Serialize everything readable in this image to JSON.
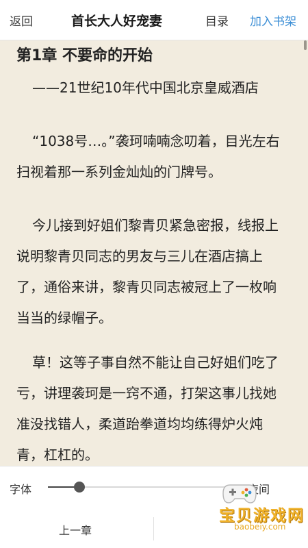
{
  "topbar": {
    "back_label": "返回",
    "title": "首长大人好宠妻",
    "toc_label": "目录",
    "add_shelf_label": "加入书架",
    "add_shelf_color": "#3d8fd6"
  },
  "reader": {
    "background_color": "#f2ecdf",
    "chapter_title": "第1章 不要命的开始",
    "paragraphs": [
      "——21世纪10年代中国北京皇威酒店",
      "“1038号…。”袭珂喃喃念叨着，目光左右扫视着那一系列金灿灿的门牌号。",
      "今儿接到好姐们黎青贝紧急密报，线报上说明黎青贝同志的男友与三儿在酒店搞上了，通俗来讲，黎青贝同志被冠上了一枚响当当的绿帽子。",
      "草！这等子事自然不能让自己好姐们吃了亏，讲理袭珂是一窍不通，打架这事儿找她准没找错人，柔道跆拳道均均练得炉火炖青，杠杠的。"
    ]
  },
  "panel": {
    "font_label": "字体",
    "font_size_level": 0.16,
    "night_label": "夜间",
    "prev_chapter_label": "上一章"
  },
  "watermark": {
    "logo_icon": "gamepad-icon",
    "text": "宝贝游戏网",
    "url": "baobeiy.com"
  }
}
